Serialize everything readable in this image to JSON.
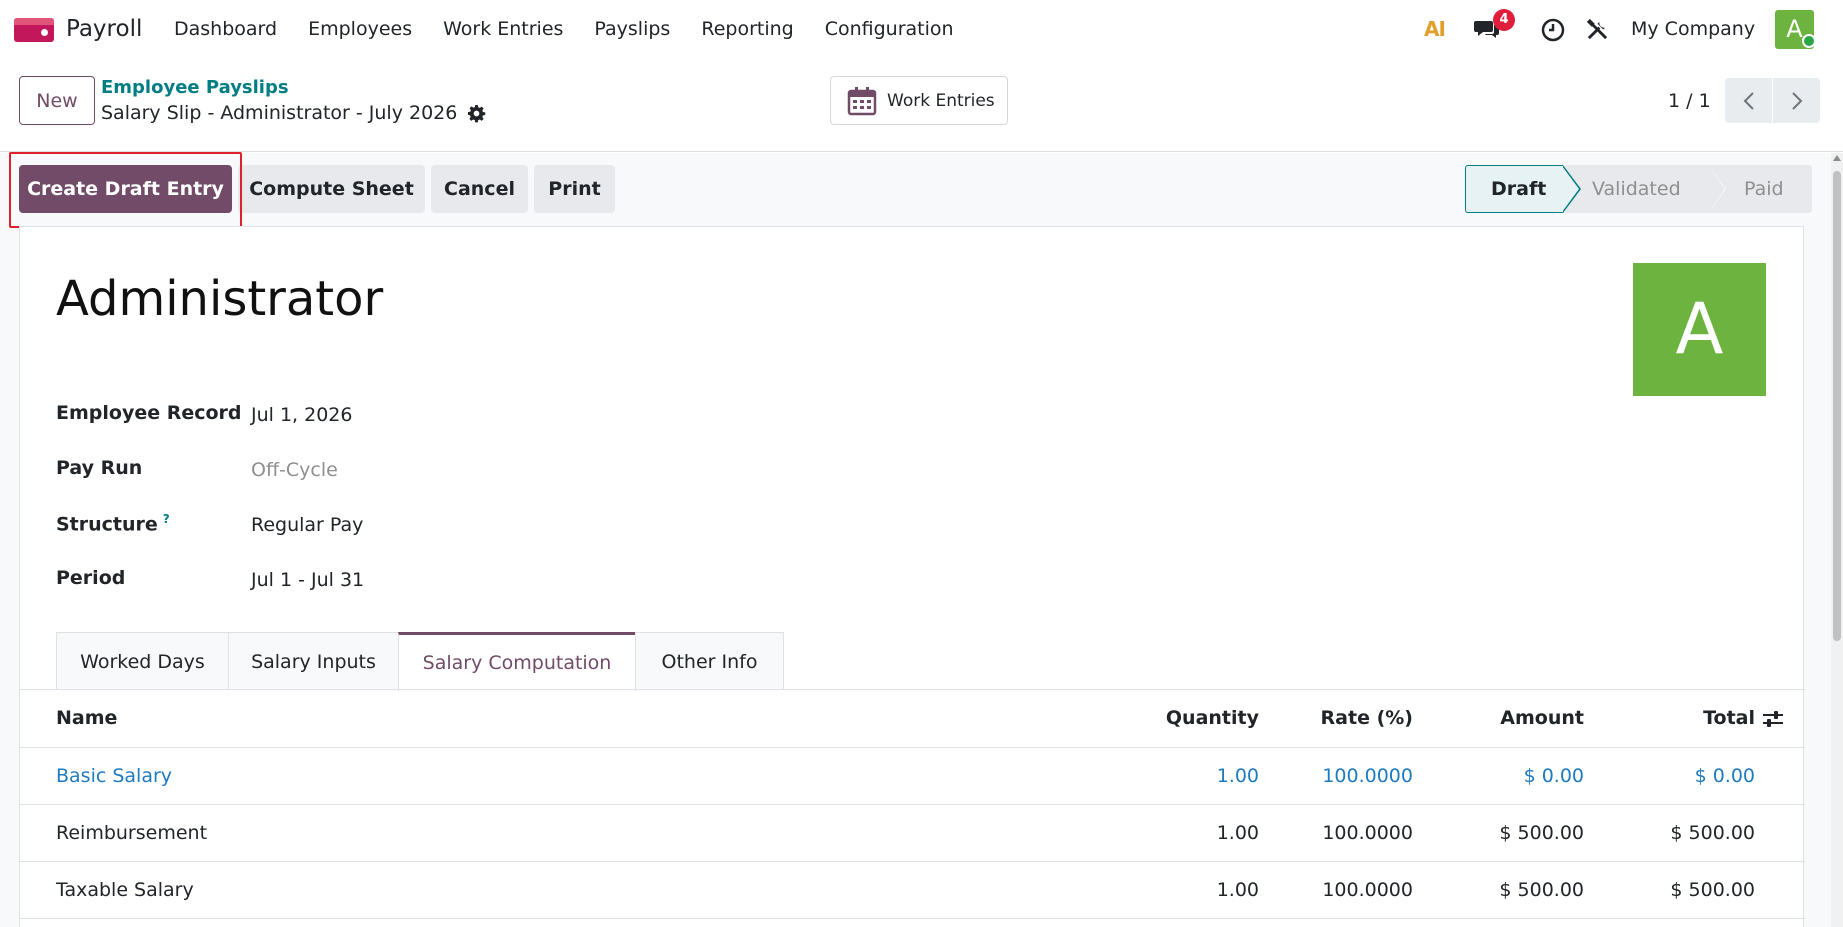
{
  "navbar": {
    "app_name": "Payroll",
    "menu": [
      "Dashboard",
      "Employees",
      "Work Entries",
      "Payslips",
      "Reporting",
      "Configuration"
    ],
    "ai_label": "AI",
    "messages_count": "4",
    "company": "My Company",
    "user_initial": "A"
  },
  "control": {
    "new_label": "New",
    "breadcrumb_parent": "Employee Payslips",
    "breadcrumb_current": "Salary Slip - Administrator - July 2026",
    "work_entries_label": "Work Entries",
    "pager": "1 / 1"
  },
  "statusbar": {
    "buttons": [
      "Create Draft Entry",
      "Compute Sheet",
      "Cancel",
      "Print"
    ],
    "stages": [
      "Draft",
      "Validated",
      "Paid"
    ],
    "active_stage": "Draft"
  },
  "record": {
    "title": "Administrator",
    "avatar_initial": "A",
    "fields": [
      {
        "label": "Employee Record",
        "value": "Jul 1, 2026"
      },
      {
        "label": "Pay Run",
        "value": "Off-Cycle"
      },
      {
        "label": "Structure",
        "value": "Regular Pay",
        "help": "?"
      },
      {
        "label": "Period",
        "value": "Jul 1 - Jul 31"
      }
    ]
  },
  "tabs": [
    "Worked Days",
    "Salary Inputs",
    "Salary Computation",
    "Other Info"
  ],
  "active_tab": "Salary Computation",
  "table": {
    "headers": {
      "name": "Name",
      "quantity": "Quantity",
      "rate": "Rate (%)",
      "amount": "Amount",
      "total": "Total"
    },
    "rows": [
      {
        "name": "Basic Salary",
        "quantity": "1.00",
        "rate": "100.0000",
        "amount": "$ 0.00",
        "total": "$ 0.00"
      },
      {
        "name": "Reimbursement",
        "quantity": "1.00",
        "rate": "100.0000",
        "amount": "$ 500.00",
        "total": "$ 500.00"
      },
      {
        "name": "Taxable Salary",
        "quantity": "1.00",
        "rate": "100.0000",
        "amount": "$ 500.00",
        "total": "$ 500.00"
      }
    ]
  },
  "colors": {
    "brand": "#714b67",
    "accent": "#017e84",
    "link": "#1f7bc0",
    "avatar": "#6db33f",
    "badge": "#e01e3c",
    "highlight": "#e0202a"
  }
}
